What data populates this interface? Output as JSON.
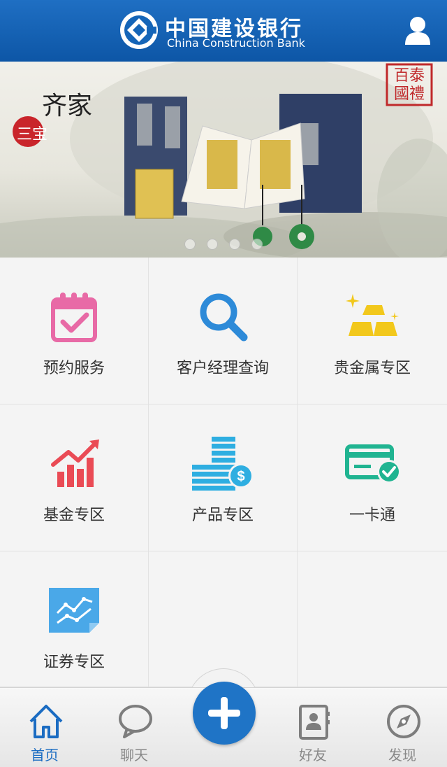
{
  "header": {
    "bank_name_cn": "中国建设银行",
    "bank_name_en": "China Construction Bank",
    "logo_icon": "ccb-logo-icon",
    "user_icon": "user-icon",
    "color": "#1565b8"
  },
  "banner": {
    "slide_count": 4,
    "active_slide": 4,
    "seal_text": "百泰國禮",
    "brand_text": "齐家",
    "badge_text": "三宝"
  },
  "services": [
    {
      "label": "预约服务",
      "icon": "calendar-check-icon"
    },
    {
      "label": "客户经理查询",
      "icon": "search-icon"
    },
    {
      "label": "贵金属专区",
      "icon": "gold-bars-icon"
    },
    {
      "label": "基金专区",
      "icon": "bar-chart-trend-icon"
    },
    {
      "label": "产品专区",
      "icon": "coin-stack-icon"
    },
    {
      "label": "一卡通",
      "icon": "card-check-icon"
    },
    {
      "label": "证券专区",
      "icon": "line-chart-icon"
    }
  ],
  "tabbar": {
    "items": [
      {
        "label": "首页",
        "icon": "home-icon",
        "active": true
      },
      {
        "label": "聊天",
        "icon": "chat-bubble-icon",
        "active": false
      },
      {
        "label": "好友",
        "icon": "contacts-icon",
        "active": false
      },
      {
        "label": "发现",
        "icon": "compass-icon",
        "active": false
      }
    ],
    "center_icon": "plus-icon",
    "active_color": "#1b6cc2"
  }
}
